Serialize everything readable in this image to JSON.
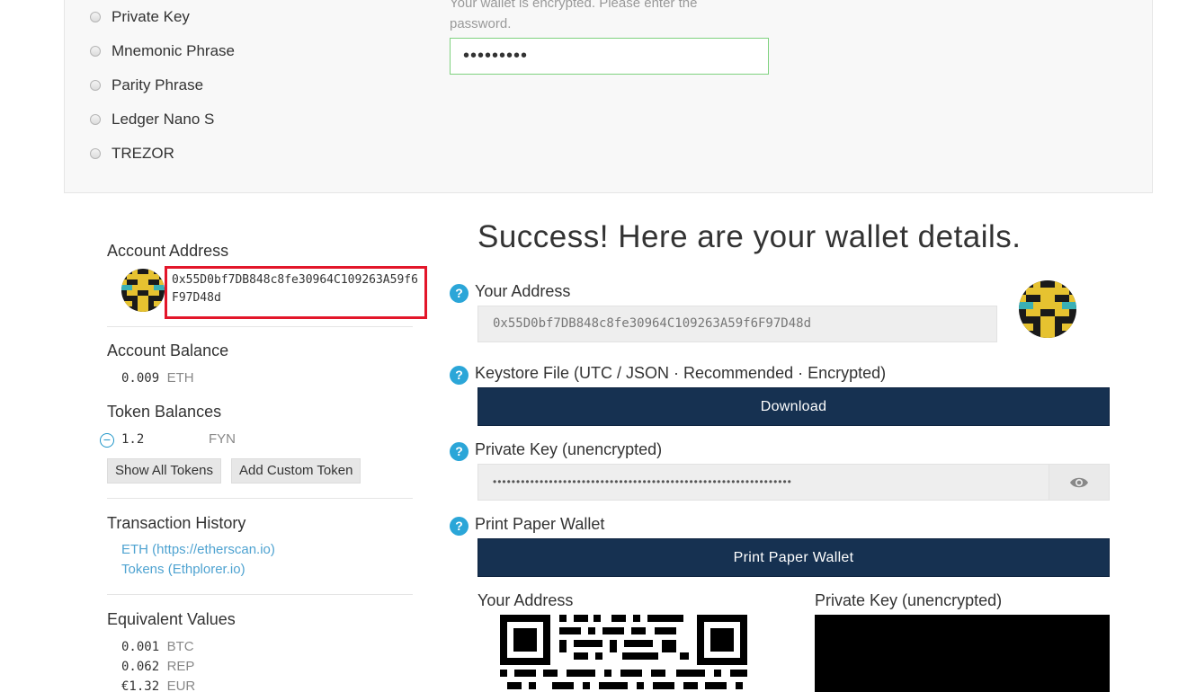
{
  "unlock_methods": [
    "Private Key",
    "Mnemonic Phrase",
    "Parity Phrase",
    "Ledger Nano S",
    "TREZOR"
  ],
  "password": {
    "help": "Your wallet is encrypted. Please enter the password.",
    "value": "•••••••••"
  },
  "sidebar": {
    "account_address_label": "Account Address",
    "account_address": "0x55D0bf7DB848c8fe30964C109263A59f6F97D48d",
    "account_balance_label": "Account Balance",
    "balance_value": "0.009",
    "balance_unit": "ETH",
    "token_balances_label": "Token Balances",
    "token_value": "1.2",
    "token_symbol": "FYN",
    "show_all_tokens": "Show All Tokens",
    "add_custom_token": "Add Custom Token",
    "transaction_history_label": "Transaction History",
    "tx_links": [
      "ETH (https://etherscan.io)",
      "Tokens (Ethplorer.io)"
    ],
    "equivalent_values_label": "Equivalent Values",
    "equivalents": [
      {
        "value": "0.001",
        "unit": "BTC"
      },
      {
        "value": "0.062",
        "unit": "REP"
      },
      {
        "value": "€1.32",
        "unit": "EUR"
      }
    ]
  },
  "main": {
    "title": "Success! Here are your wallet details.",
    "your_address_label": "Your Address",
    "your_address_value": "0x55D0bf7DB848c8fe30964C109263A59f6F97D48d",
    "keystore_label": "Keystore File (UTC / JSON · Recommended · Encrypted)",
    "download_label": "Download",
    "private_key_label": "Private Key (unencrypted)",
    "private_key_masked": "••••••••••••••••••••••••••••••••••••••••••••••••••••••••••••••••",
    "print_label": "Print Paper Wallet",
    "print_button": "Print Paper Wallet",
    "paper_address_label": "Your Address",
    "paper_private_label": "Private Key (unencrypted)"
  },
  "colors": {
    "accent_blue": "#2ba6d8",
    "dark_button": "#163151",
    "highlight_red": "#e3162a",
    "valid_green": "#7fd27f"
  }
}
